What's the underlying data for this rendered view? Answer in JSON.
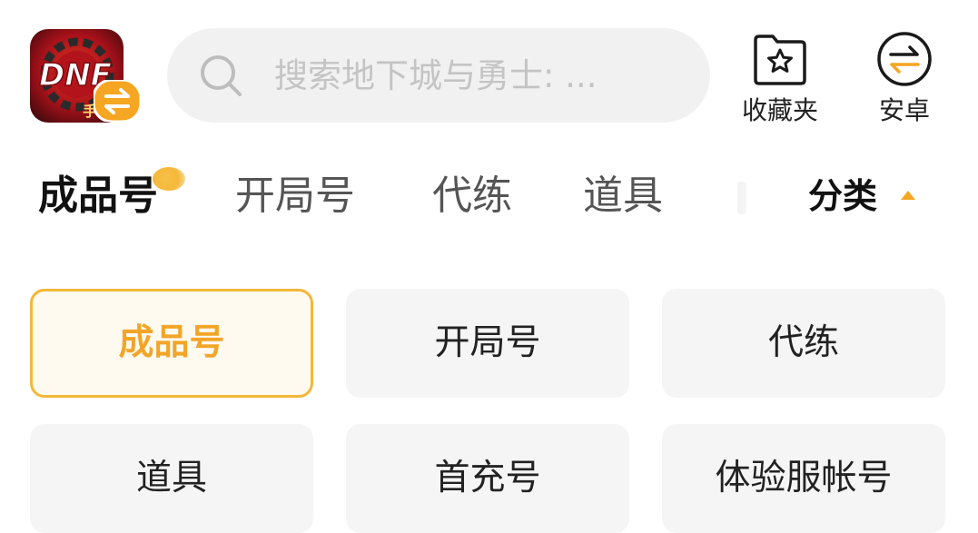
{
  "header": {
    "logo_text": "DNF",
    "logo_badge_text": "手",
    "search": {
      "placeholder": "搜索地下城与勇士: ..."
    },
    "favorites_label": "收藏夹",
    "android_label": "安卓"
  },
  "tabs": [
    {
      "label": "成品号",
      "active": true
    },
    {
      "label": "开局号",
      "active": false
    },
    {
      "label": "代练",
      "active": false
    },
    {
      "label": "道具",
      "active": false
    }
  ],
  "category_toggle_label": "分类",
  "categories": [
    {
      "label": "成品号",
      "selected": true
    },
    {
      "label": "开局号",
      "selected": false
    },
    {
      "label": "代练",
      "selected": false
    },
    {
      "label": "道具",
      "selected": false
    },
    {
      "label": "首充号",
      "selected": false
    },
    {
      "label": "体验服帐号",
      "selected": false
    }
  ],
  "colors": {
    "accent": "#f3b73a",
    "accent_text": "#f2a528",
    "logo_red": "#c8151b",
    "badge_orange": "#f5a623"
  },
  "icons": {
    "logo": "dnf-game-icon",
    "search": "search-icon",
    "favorites": "star-folder-icon",
    "android": "swap-arrows-icon",
    "category_caret": "caret-up-icon"
  }
}
